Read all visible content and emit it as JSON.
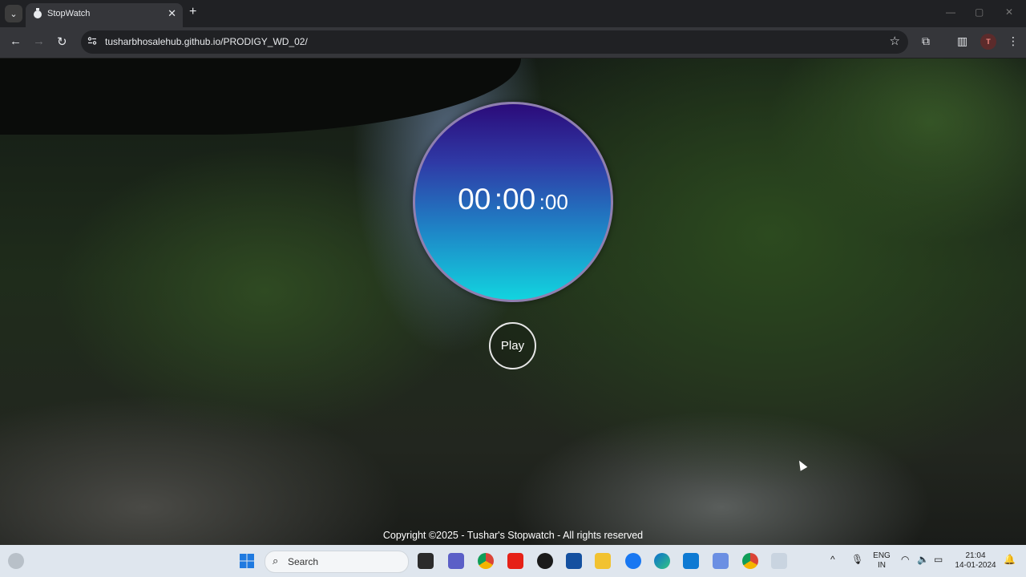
{
  "browser": {
    "tab_title": "StopWatch",
    "url": "tusharbhosalehub.github.io/PRODIGY_WD_02/",
    "profile_initial": "T"
  },
  "stopwatch": {
    "hours": "00",
    "minutes": ":00",
    "seconds": ":00",
    "play_label": "Play",
    "footer": "Copyright ©2025 - Tushar's Stopwatch - All rights reserved"
  },
  "taskbar": {
    "search_label": "Search",
    "lang_top": "ENG",
    "lang_bottom": "IN",
    "time": "21:04",
    "date": "14-01-2024"
  },
  "colors": {
    "circle_top": "#2b0b7a",
    "circle_bottom": "#12d4df"
  },
  "icons": [
    "search-icon",
    "windows-start-icon",
    "chrome-icon",
    "youtube-icon",
    "file-explorer-icon",
    "facebook-icon",
    "edge-icon",
    "vscode-icon",
    "wifi-icon",
    "volume-icon",
    "battery-icon"
  ]
}
